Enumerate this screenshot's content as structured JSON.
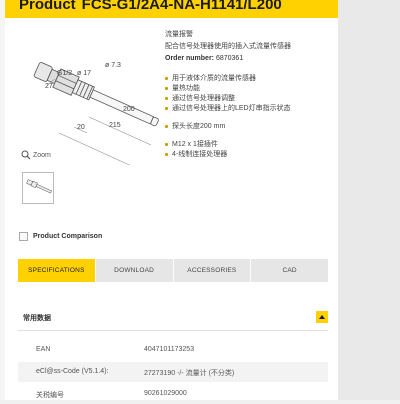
{
  "header": {
    "label": "Product",
    "product_code": "FCS-G1/2A4-NA-H1141/L200"
  },
  "product": {
    "category": "流量报警",
    "description": "配合信号处理器使用的插入式流量传感器",
    "order_number_label": "Order number:",
    "order_number": "6870361",
    "features": [
      "用于液体介质的流量传感器",
      "量热功能",
      "通过信号处理器调整",
      "通过信号处理器上的LED灯串指示状态",
      "探头长度200 mm",
      "M12 x 1接插件",
      "4-线制连接处理器"
    ]
  },
  "drawing": {
    "dim_27": "27",
    "dim_g1": "G1/2",
    "dim_d17": "ø 17",
    "dim_d73": "ø 7.3",
    "dim_200": "200",
    "dim_20": "20",
    "dim_215": "215"
  },
  "zoom_label": "Zoom",
  "comparison_label": "Product Comparison",
  "tabs": [
    {
      "label": "SPECIFICATIONS"
    },
    {
      "label": "DOWNLOAD"
    },
    {
      "label": "ACCESSORIES"
    },
    {
      "label": "CAD"
    }
  ],
  "specs": {
    "section_title": "常用数据",
    "rows": [
      {
        "key": "EAN",
        "value": "4047101173253"
      },
      {
        "key": "eCl@ss-Code (V5.1.4):",
        "value": "27273190 -/- 流量计 (不分类)"
      },
      {
        "key": "关税编号",
        "value": "90261029000"
      }
    ]
  },
  "colors": {
    "accent": "#ffd100",
    "tab_inactive": "#e6e6e6",
    "bullet": "#c8a000"
  }
}
